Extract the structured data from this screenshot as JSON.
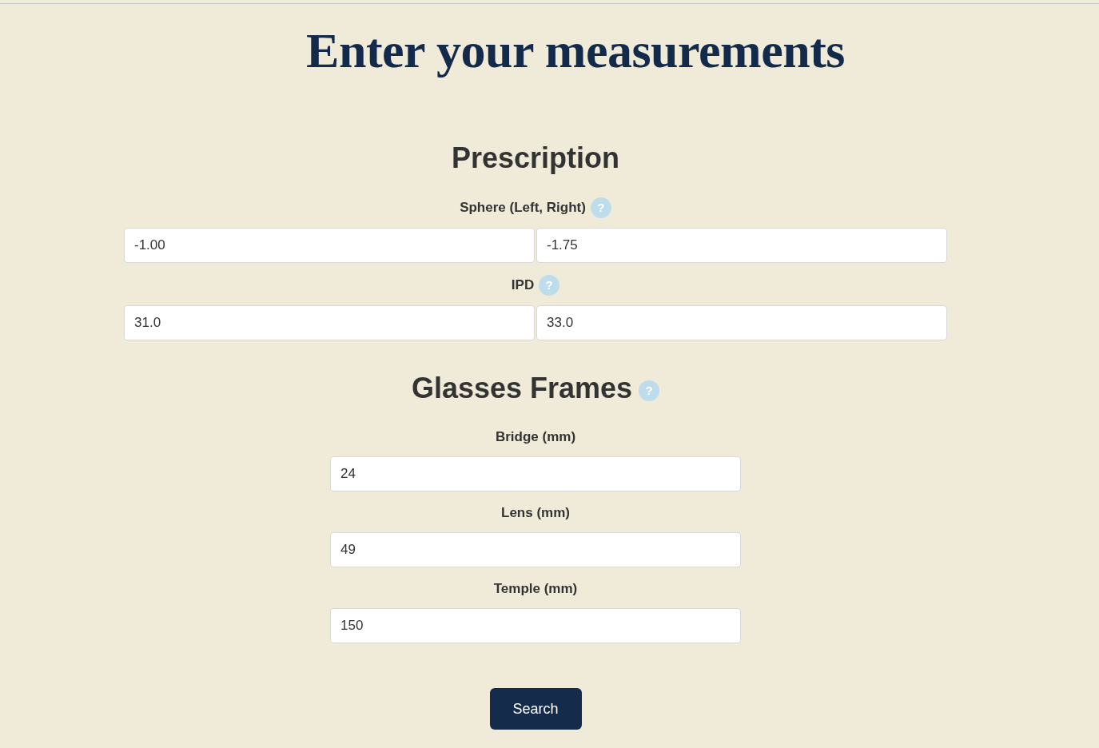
{
  "title": "Enter your measurements",
  "sections": [
    {
      "heading": "Prescription",
      "fields": [
        {
          "label": "Sphere (Left, Right)",
          "help": "?",
          "values": [
            "-1.00",
            "-1.75"
          ]
        },
        {
          "label": "IPD",
          "help": "?",
          "values": [
            "31.0",
            "33.0"
          ]
        }
      ]
    },
    {
      "heading": "Glasses Frames",
      "help": "?",
      "fields": [
        {
          "label": "Bridge (mm)",
          "values": [
            "24"
          ]
        },
        {
          "label": "Lens (mm)",
          "values": [
            "49"
          ]
        },
        {
          "label": "Temple (mm)",
          "values": [
            "150"
          ]
        }
      ]
    }
  ],
  "submit": "Search"
}
